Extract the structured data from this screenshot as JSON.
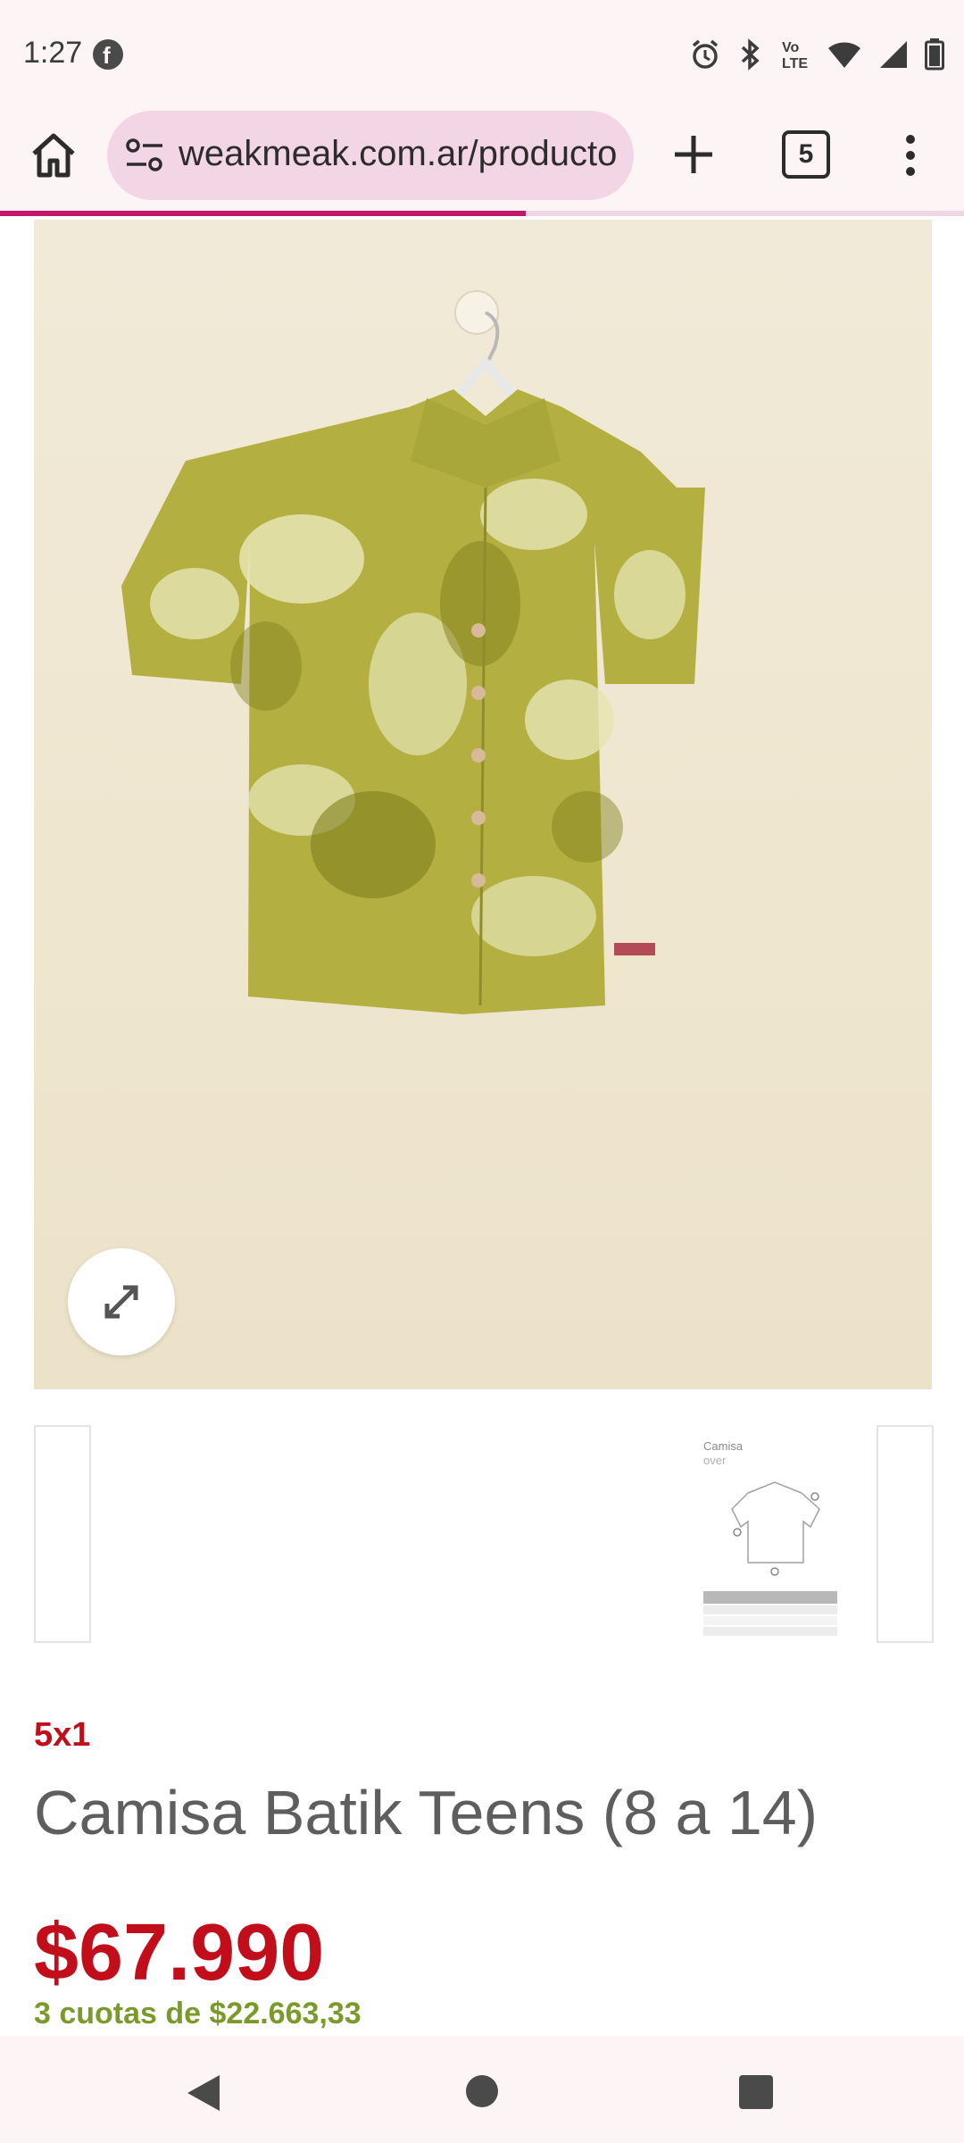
{
  "status_bar": {
    "time": "1:27",
    "icons": [
      "facebook-icon",
      "alarm-icon",
      "bluetooth-icon",
      "volte-icon",
      "wifi-icon",
      "signal-icon",
      "battery-icon"
    ]
  },
  "browser": {
    "url": "weakmeak.com.ar/producto",
    "tab_count": "5",
    "load_progress": 0.545,
    "accent_color": "#c2186b"
  },
  "product": {
    "promo_label": "5x1",
    "title": "Camisa Batik Teens (8 a 14)",
    "price": "$67.990",
    "installments": "3 cuotas de $22.663,33",
    "price_color": "#c20e1a",
    "installments_color": "#7a9a2a"
  },
  "size_chart_thumb": {
    "title_line1": "Camisa",
    "title_line2": "over"
  }
}
